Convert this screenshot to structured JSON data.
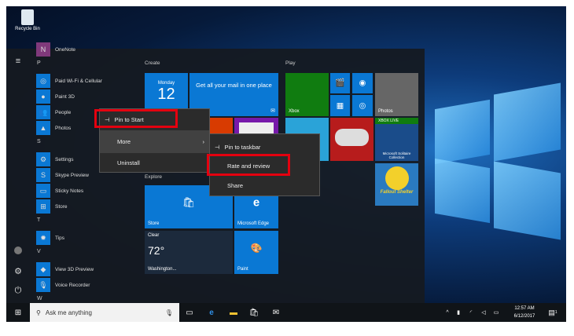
{
  "desktop": {
    "recycle_bin": "Recycle Bin"
  },
  "start": {
    "apps": [
      {
        "label": "OneNote",
        "color": "#80397b",
        "glyph": "N"
      },
      {
        "letter": "P"
      },
      {
        "label": "Paid Wi-Fi & Cellular",
        "color": "#0a78d4",
        "glyph": "◎"
      },
      {
        "label": "Paint 3D",
        "color": "#0a78d4",
        "glyph": "●"
      },
      {
        "label": "People",
        "color": "#0a78d4",
        "glyph": "👥"
      },
      {
        "label": "Photos",
        "color": "#0a78d4",
        "glyph": "▲"
      },
      {
        "letter": "S"
      },
      {
        "label": "Settings",
        "color": "#0a78d4",
        "glyph": "⚙"
      },
      {
        "label": "Skype Preview",
        "color": "#0a78d4",
        "glyph": "S"
      },
      {
        "label": "Sticky Notes",
        "color": "#0a78d4",
        "glyph": "▭"
      },
      {
        "label": "Store",
        "color": "#0a78d4",
        "glyph": "⊞"
      },
      {
        "letter": "T"
      },
      {
        "label": "Tips",
        "color": "#0a78d4",
        "glyph": "✹"
      },
      {
        "letter": "V"
      },
      {
        "label": "View 3D Preview",
        "color": "#0a78d4",
        "glyph": "◆"
      },
      {
        "label": "Voice Recorder",
        "color": "#0a78d4",
        "glyph": "🎙"
      },
      {
        "letter": "W"
      }
    ],
    "groups": {
      "create": "Create",
      "play": "Play",
      "explore": "Explore"
    },
    "tiles": {
      "calendar_day": "Monday",
      "calendar_date": "12",
      "mail": "Get all your mail in one place",
      "xbox": "Xbox",
      "photos": "Photos",
      "xbox_live": "XBOX LIVE",
      "solitaire": "Microsoft Solitaire Collection",
      "fallout": "Fallout Shelter",
      "store": "Store",
      "edge": "Microsoft Edge",
      "weather_cond": "Clear",
      "weather_temp": "72°",
      "weather_city": "Washington...",
      "paint": "Paint"
    }
  },
  "context_menu": {
    "pin_to_start": "Pin to Start",
    "more": "More",
    "uninstall": "Uninstall"
  },
  "submenu": {
    "pin_to_taskbar": "Pin to taskbar",
    "rate_review": "Rate and review",
    "share": "Share"
  },
  "taskbar": {
    "search_placeholder": "Ask me anything",
    "time": "12:57 AM",
    "date": "6/12/2017",
    "notifications": "1"
  }
}
